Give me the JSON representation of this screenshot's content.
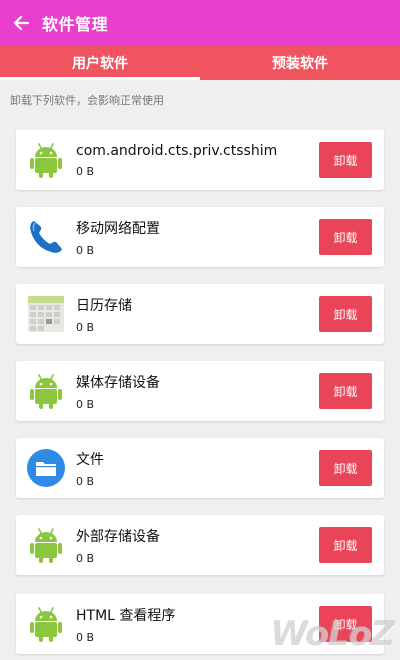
{
  "appbar": {
    "title": "软件管理",
    "back_icon": "arrow-left-icon"
  },
  "tabs": [
    {
      "label": "用户软件",
      "active": true
    },
    {
      "label": "预装软件",
      "active": false
    }
  ],
  "hint": "卸载下列软件，会影响正常使用",
  "uninstall_label": "卸载",
  "apps": [
    {
      "name": "com.android.cts.priv.ctsshim",
      "size": "0 B",
      "icon": "android-icon"
    },
    {
      "name": "移动网络配置",
      "size": "0 B",
      "icon": "phone-icon"
    },
    {
      "name": "日历存储",
      "size": "0 B",
      "icon": "calendar-icon"
    },
    {
      "name": "媒体存储设备",
      "size": "0 B",
      "icon": "android-icon"
    },
    {
      "name": "文件",
      "size": "0 B",
      "icon": "folder-icon"
    },
    {
      "name": "外部存储设备",
      "size": "0 B",
      "icon": "android-icon"
    },
    {
      "name": "HTML 查看程序",
      "size": "0 B",
      "icon": "android-icon"
    }
  ],
  "colors": {
    "appbar": "#e83fcf",
    "tabs": "#f0545f",
    "button": "#e94457",
    "background": "#efefef"
  },
  "watermark": "WoLoZ"
}
